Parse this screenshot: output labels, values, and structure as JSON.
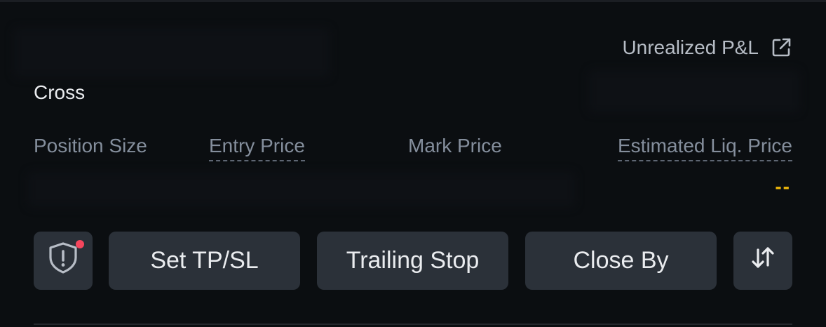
{
  "header": {
    "unrealized_pnl_label": "Unrealized P&L",
    "external_link_icon": "external-link-icon"
  },
  "position": {
    "margin_mode": "Cross",
    "columns": {
      "position_size": "Position Size",
      "entry_price": "Entry Price",
      "mark_price": "Mark Price",
      "estimated_liq_price": "Estimated Liq. Price"
    },
    "estimated_liq_value": "--"
  },
  "actions": {
    "shield_icon": "shield-alert-icon",
    "set_tpsl": "Set TP/SL",
    "trailing_stop": "Trailing Stop",
    "close_by": "Close By",
    "reverse_icon": "reverse-arrows-icon"
  },
  "colors": {
    "background": "#0b0e11",
    "button_bg": "#2b3139",
    "accent_yellow": "#f0b90b",
    "alert_red": "#f6465d",
    "muted_text": "#848e9c"
  }
}
